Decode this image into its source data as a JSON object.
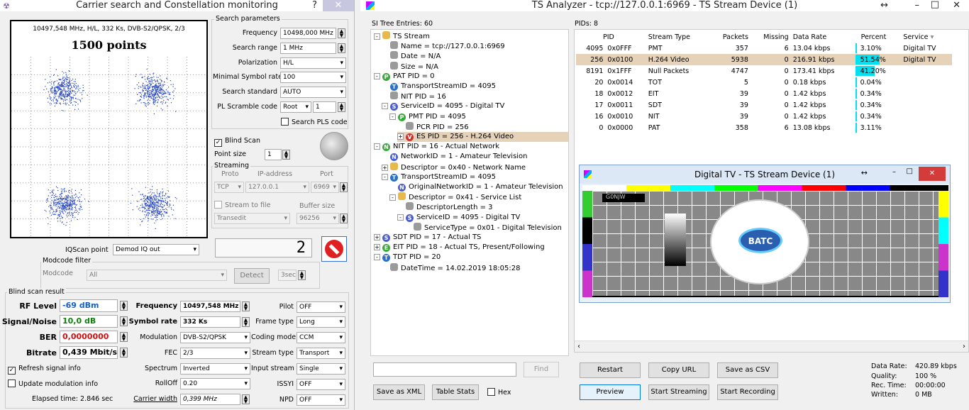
{
  "left": {
    "title": "Carrier search and Constellation monitoring",
    "help": "?",
    "close": "✕",
    "plot_caption": "10497,548 MHz, H/L, 332 Ks, DVB-S2/QPSK, 2/3",
    "plot_points": "1500 points",
    "sp": {
      "title": "Search parameters",
      "frequency_label": "Frequency",
      "frequency_value": "10498,000 MHz",
      "range_label": "Search range",
      "range_value": "1 MHz",
      "pol_label": "Polarization",
      "pol_value": "H/L",
      "msr_label": "Minimal Symbol rate",
      "msr_value": "100",
      "std_label": "Search standard",
      "std_value": "AUTO",
      "pls_label": "PL Scramble code",
      "pls_mode": "Root",
      "pls_value": "1",
      "search_pls": "Search PLS code"
    },
    "blind_scan": "Blind Scan",
    "point_size_label": "Point size",
    "point_size": "1",
    "streaming": {
      "title": "Streaming",
      "proto_h": "Proto",
      "ip_h": "IP-address",
      "port_h": "Port",
      "proto": "TCP",
      "ip": "127.0.0.1",
      "port": "6969",
      "to_file": "Stream to file",
      "buffer_h": "Buffer size",
      "file": "Transedit",
      "buffer": "96256"
    },
    "iq_label": "IQScan point",
    "iq_value": "Demod IQ out",
    "counter": "2",
    "modcode": {
      "title": "Modcode filter",
      "label": "Modcode",
      "value": "All",
      "detect": "Detect",
      "sec": "3sec"
    },
    "result": {
      "title": "Blind scan result",
      "rf_label": "RF Level",
      "rf_value": "-69 dBm",
      "sn_label": "Signal/Noise",
      "sn_value": "10,0 dB",
      "ber_label": "BER",
      "ber_value": "0,0000000",
      "br_label": "Bitrate",
      "br_value": "0,439 Mbit/s",
      "freq_label": "Frequency",
      "freq_value": "10497,548 MHz",
      "sym_label": "Symbol rate",
      "sym_value": "332 Ks",
      "mod_label": "Modulation",
      "mod_value": "DVB-S2/QPSK",
      "fec_label": "FEC",
      "fec_value": "2/3",
      "spec_label": "Spectrum",
      "spec_value": "Inverted",
      "roll_label": "RollOff",
      "roll_value": "0.20",
      "cw_label": "Carrier width",
      "cw_value": "0,399 MHz",
      "pilot_label": "Pilot",
      "pilot_value": "OFF",
      "frame_label": "Frame type",
      "frame_value": "Long",
      "coding_label": "Coding mode",
      "coding_value": "CCM",
      "stype_label": "Stream type",
      "stype_value": "Transport",
      "istream_label": "Input stream",
      "istream_value": "Single",
      "issyi_label": "ISSYI",
      "issyi_value": "OFF",
      "npd_label": "NPD",
      "npd_value": "OFF",
      "refresh": "Refresh signal info",
      "update": "Update modulation info",
      "elapsed": "Elapsed time: 2.846 sec"
    }
  },
  "right": {
    "title": "TS Analyzer - tcp://127.0.0.1:6969 - TS Stream Device (1)",
    "si_header": "SI Tree Entries: 60",
    "pids_header": "PIDs: 8",
    "tree": [
      "TS Stream",
      "Name = tcp://127.0.0.1:6969",
      "Date = N/A",
      "Size = N/A",
      "PAT PID = 0",
      "TransportStreamID = 4095",
      "NIT PID = 16",
      "ServiceID = 4095 - Digital TV",
      "PMT PID = 4095",
      "PCR PID = 256",
      "ES PID = 256 - H.264 Video",
      "NIT PID = 16 - Actual Network",
      "NetworkID = 1 - Amateur Television",
      "Descriptor = 0x40 - Network Name",
      "TransportStreamID = 4095",
      "OriginalNetworkID = 1 - Amateur Television",
      "Descriptor = 0x41 - Service List",
      "DescriptorLength = 3",
      "ServiceID = 4095 - Digital TV",
      "ServiceType = 0x01 - Digital Television",
      "SDT PID = 17 - Actual TS",
      "EIT PID = 18 - Actual TS, Present/Following",
      "TDT PID = 20",
      "DateTime = 14.02.2019 18:05:28"
    ],
    "columns": [
      "PID",
      "Stream Type",
      "Packets",
      "Missing",
      "Data Rate",
      "Percent",
      "Service"
    ],
    "rows": [
      {
        "pid": "4095",
        "hex": "0x0FFF",
        "type": "PMT",
        "packets": "357",
        "missing": "6",
        "rate": "13.04 kbps",
        "percent": "3.10%",
        "pct": 3.1,
        "service": "Digital TV"
      },
      {
        "pid": "256",
        "hex": "0x0100",
        "type": "H.264 Video",
        "packets": "5938",
        "missing": "0",
        "rate": "216.91 kbps",
        "percent": "51.54%",
        "pct": 51.54,
        "service": "Digital TV"
      },
      {
        "pid": "8191",
        "hex": "0x1FFF",
        "type": "Null Packets",
        "packets": "4747",
        "missing": "0",
        "rate": "173.41 kbps",
        "percent": "41.20%",
        "pct": 41.2,
        "service": ""
      },
      {
        "pid": "20",
        "hex": "0x0014",
        "type": "TOT",
        "packets": "5",
        "missing": "0",
        "rate": "0.18 kbps",
        "percent": "0.04%",
        "pct": 0.04,
        "service": ""
      },
      {
        "pid": "18",
        "hex": "0x0012",
        "type": "EIT",
        "packets": "39",
        "missing": "0",
        "rate": "1.42 kbps",
        "percent": "0.34%",
        "pct": 0.34,
        "service": ""
      },
      {
        "pid": "17",
        "hex": "0x0011",
        "type": "SDT",
        "packets": "39",
        "missing": "0",
        "rate": "1.42 kbps",
        "percent": "0.34%",
        "pct": 0.34,
        "service": ""
      },
      {
        "pid": "16",
        "hex": "0x0010",
        "type": "NIT",
        "packets": "39",
        "missing": "0",
        "rate": "1.42 kbps",
        "percent": "0.34%",
        "pct": 0.34,
        "service": ""
      },
      {
        "pid": "0",
        "hex": "0x0000",
        "type": "PAT",
        "packets": "358",
        "missing": "6",
        "rate": "13.08 kbps",
        "percent": "3.11%",
        "pct": 3.11,
        "service": ""
      }
    ],
    "video_title": "Digital TV - TS Stream Device (1)",
    "callsign": "G0NJW",
    "logo": "BATC",
    "find": "Find",
    "save_xml": "Save as XML",
    "table_stats": "Table Stats",
    "hex": "Hex",
    "restart": "Restart",
    "copy_url": "Copy URL",
    "save_csv": "Save as CSV",
    "preview": "Preview",
    "start_streaming": "Start Streaming",
    "start_recording": "Start Recording",
    "stats": {
      "rate_l": "Data Rate:",
      "rate_v": "420.89 kbps",
      "quality_l": "Quality:",
      "quality_v": "100 %",
      "rec_l": "Rec. Time:",
      "rec_v": "00:00:00",
      "written_l": "Written:",
      "written_v": "0 MB"
    }
  }
}
